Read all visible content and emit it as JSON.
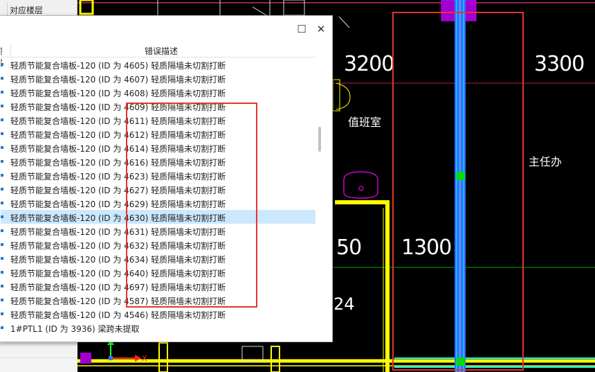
{
  "cad": {
    "dims": [
      "3200",
      "3300",
      "50",
      "1300",
      "24"
    ],
    "rooms": [
      "值班室",
      "主任办"
    ]
  },
  "top_tab": {
    "label": "对应楼层"
  },
  "dialog": {
    "columns": [
      "楼层",
      "错误描述"
    ],
    "maximize_glyph": "☐",
    "close_glyph": "✕",
    "rows": [
      "轻质节能复合墙板-120 (ID 为 4605) 轻质隔墙未切割打断",
      "轻质节能复合墙板-120 (ID 为 4607) 轻质隔墙未切割打断",
      "轻质节能复合墙板-120 (ID 为 4608) 轻质隔墙未切割打断",
      "轻质节能复合墙板-120 (ID 为 4609) 轻质隔墙未切割打断",
      "轻质节能复合墙板-120 (ID 为 4611) 轻质隔墙未切割打断",
      "轻质节能复合墙板-120 (ID 为 4612) 轻质隔墙未切割打断",
      "轻质节能复合墙板-120 (ID 为 4614) 轻质隔墙未切割打断",
      "轻质节能复合墙板-120 (ID 为 4616) 轻质隔墙未切割打断",
      "轻质节能复合墙板-120 (ID 为 4623) 轻质隔墙未切割打断",
      "轻质节能复合墙板-120 (ID 为 4627) 轻质隔墙未切割打断",
      "轻质节能复合墙板-120 (ID 为 4629) 轻质隔墙未切割打断",
      "轻质节能复合墙板-120 (ID 为 4630) 轻质隔墙未切割打断",
      "轻质节能复合墙板-120 (ID 为 4631) 轻质隔墙未切割打断",
      "轻质节能复合墙板-120 (ID 为 4632) 轻质隔墙未切割打断",
      "轻质节能复合墙板-120 (ID 为 4634) 轻质隔墙未切割打断",
      "轻质节能复合墙板-120 (ID 为 4640) 轻质隔墙未切割打断",
      "轻质节能复合墙板-120 (ID 为 4697) 轻质隔墙未切割打断",
      "轻质节能复合墙板-120 (ID 为 4587) 轻质隔墙未切割打断",
      "轻质节能复合墙板-120 (ID 为 4546) 轻质隔墙未切割打断",
      "1#PTL1 (ID 为 3936) 梁跨未提取"
    ],
    "selected_row_id": "4630"
  },
  "axis_label": "X",
  "colors": {
    "highlight": "#e8322c",
    "selection": "#cce8ff",
    "wall": "#ffff00",
    "cyan": "#00ffff"
  }
}
